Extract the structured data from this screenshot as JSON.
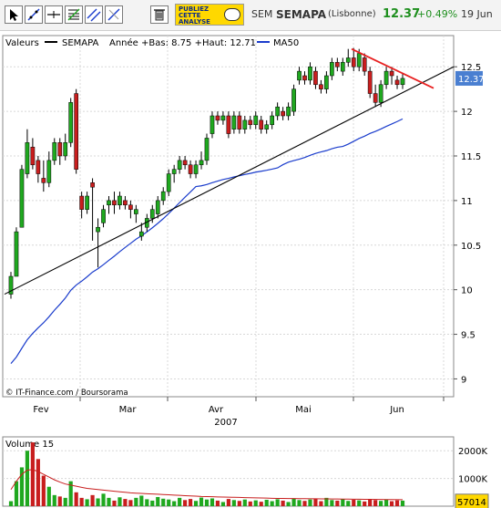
{
  "toolbar": {
    "tools": [
      {
        "icon": "pointer-icon"
      },
      {
        "icon": "trendline-icon"
      },
      {
        "icon": "horizontal-line-icon"
      },
      {
        "icon": "fibonacci-icon"
      },
      {
        "icon": "parallel-lines-icon"
      },
      {
        "icon": "diagonal-line-icon"
      },
      {
        "icon": "trash-icon"
      }
    ],
    "publish_line1": "PUBLIEZ",
    "publish_line2": "CETTE",
    "publish_line3": "ANALYSE",
    "publish_icon": "speech-bubble-icon",
    "market": "SEM",
    "name": "SEMAPA",
    "exchange": "(Lisbonne)",
    "last": "12.37",
    "change": "+0.49%",
    "date": "19 Jun"
  },
  "colors": {
    "up": "#1fa81f",
    "down": "#c81e1e",
    "ma": "#1a3ccc",
    "trend": "#e82020",
    "price_tag_bg": "#4a7fd1"
  },
  "chart_data": {
    "type": "candlestick",
    "legend": {
      "label": "Valeurs",
      "series_name": "SEMAPA",
      "info": "Année +Bas: 8.75 +Haut: 12.71",
      "ma_name": "MA50"
    },
    "y_ticks": [
      "9",
      "9.5",
      "10",
      "10.5",
      "11",
      "11.5",
      "12",
      "12.5"
    ],
    "price_tag": "12.37",
    "x_months": [
      "Fev",
      "Mar",
      "Avr",
      "Mai",
      "Jun"
    ],
    "year": "2007",
    "source": "© IT-Finance.com / Boursorama",
    "candles": [
      [
        9.95,
        10.15,
        9.9,
        10.2
      ],
      [
        10.15,
        10.65,
        10.15,
        10.7
      ],
      [
        10.7,
        11.35,
        10.7,
        11.4
      ],
      [
        11.3,
        11.65,
        11.25,
        11.8
      ],
      [
        11.6,
        11.4,
        11.35,
        11.7
      ],
      [
        11.45,
        11.3,
        11.2,
        11.5
      ],
      [
        11.25,
        11.2,
        11.1,
        11.45
      ],
      [
        11.2,
        11.45,
        11.15,
        11.55
      ],
      [
        11.45,
        11.65,
        11.4,
        11.7
      ],
      [
        11.65,
        11.5,
        11.4,
        11.7
      ],
      [
        11.5,
        11.65,
        11.45,
        11.75
      ],
      [
        11.65,
        12.1,
        11.6,
        12.15
      ],
      [
        12.2,
        11.35,
        11.3,
        12.25
      ],
      [
        11.05,
        10.9,
        10.8,
        11.1
      ],
      [
        10.9,
        11.05,
        10.85,
        11.1
      ],
      [
        11.2,
        11.15,
        10.55,
        11.25
      ],
      [
        10.65,
        10.7,
        10.25,
        10.8
      ],
      [
        10.75,
        10.9,
        10.7,
        10.95
      ],
      [
        10.95,
        11.0,
        10.85,
        11.05
      ],
      [
        11.0,
        10.95,
        10.85,
        11.1
      ],
      [
        10.95,
        11.05,
        10.9,
        11.1
      ],
      [
        11.0,
        10.95,
        10.9,
        11.05
      ],
      [
        10.95,
        10.9,
        10.8,
        11.0
      ],
      [
        10.85,
        10.9,
        10.75,
        10.95
      ],
      [
        10.6,
        10.65,
        10.55,
        10.75
      ],
      [
        10.7,
        10.8,
        10.65,
        10.85
      ],
      [
        10.8,
        10.9,
        10.75,
        10.95
      ],
      [
        10.85,
        11.0,
        10.8,
        11.05
      ],
      [
        11.0,
        11.1,
        10.95,
        11.15
      ],
      [
        11.1,
        11.3,
        11.05,
        11.35
      ],
      [
        11.3,
        11.35,
        11.2,
        11.4
      ],
      [
        11.35,
        11.45,
        11.3,
        11.5
      ],
      [
        11.45,
        11.4,
        11.35,
        11.5
      ],
      [
        11.4,
        11.3,
        11.25,
        11.45
      ],
      [
        11.3,
        11.4,
        11.25,
        11.45
      ],
      [
        11.4,
        11.45,
        11.35,
        11.55
      ],
      [
        11.45,
        11.7,
        11.4,
        11.75
      ],
      [
        11.75,
        11.95,
        11.7,
        12.0
      ],
      [
        11.95,
        11.9,
        11.85,
        12.0
      ],
      [
        11.9,
        11.95,
        11.85,
        12.0
      ],
      [
        11.95,
        11.75,
        11.7,
        12.0
      ],
      [
        11.8,
        11.95,
        11.75,
        12.0
      ],
      [
        11.95,
        11.8,
        11.75,
        12.0
      ],
      [
        11.8,
        11.9,
        11.75,
        11.95
      ],
      [
        11.9,
        11.85,
        11.8,
        11.95
      ],
      [
        11.85,
        11.95,
        11.8,
        12.0
      ],
      [
        11.9,
        11.8,
        11.75,
        11.95
      ],
      [
        11.8,
        11.85,
        11.75,
        11.9
      ],
      [
        11.85,
        11.95,
        11.8,
        12.0
      ],
      [
        11.95,
        12.05,
        11.9,
        12.1
      ],
      [
        12.0,
        11.95,
        11.9,
        12.05
      ],
      [
        11.95,
        12.05,
        11.9,
        12.1
      ],
      [
        12.0,
        12.25,
        11.95,
        12.3
      ],
      [
        12.35,
        12.45,
        12.3,
        12.5
      ],
      [
        12.4,
        12.35,
        12.3,
        12.45
      ],
      [
        12.35,
        12.5,
        12.3,
        12.55
      ],
      [
        12.45,
        12.3,
        12.25,
        12.5
      ],
      [
        12.3,
        12.25,
        12.2,
        12.35
      ],
      [
        12.25,
        12.4,
        12.2,
        12.45
      ],
      [
        12.4,
        12.55,
        12.35,
        12.6
      ],
      [
        12.55,
        12.5,
        12.45,
        12.6
      ],
      [
        12.45,
        12.55,
        12.4,
        12.6
      ],
      [
        12.55,
        12.6,
        12.5,
        12.7
      ],
      [
        12.6,
        12.5,
        12.45,
        12.71
      ],
      [
        12.5,
        12.65,
        12.45,
        12.7
      ],
      [
        12.6,
        12.45,
        12.4,
        12.65
      ],
      [
        12.45,
        12.2,
        12.15,
        12.5
      ],
      [
        12.2,
        12.1,
        12.05,
        12.3
      ],
      [
        12.1,
        12.3,
        12.05,
        12.35
      ],
      [
        12.3,
        12.45,
        12.25,
        12.5
      ],
      [
        12.45,
        12.4,
        12.3,
        12.5
      ],
      [
        12.35,
        12.3,
        12.25,
        12.4
      ],
      [
        12.3,
        12.37,
        12.25,
        12.42
      ]
    ],
    "volume": {
      "label": "Volume 15",
      "y_ticks": [
        "2000K",
        "1000K"
      ],
      "last_tag": "57014",
      "values": [
        180,
        900,
        1400,
        2000,
        2300,
        1700,
        1100,
        700,
        400,
        350,
        300,
        900,
        500,
        300,
        250,
        400,
        280,
        450,
        300,
        200,
        320,
        260,
        220,
        300,
        380,
        250,
        200,
        330,
        270,
        240,
        180,
        300,
        220,
        260,
        190,
        310,
        240,
        280,
        200,
        150,
        260,
        220,
        190,
        240,
        170,
        210,
        160,
        230,
        180,
        250,
        200,
        150,
        280,
        220,
        190,
        240,
        260,
        180,
        300,
        220,
        200,
        250,
        190,
        230,
        210,
        170,
        260,
        220,
        190,
        240,
        180,
        210,
        200
      ],
      "ma": [
        600,
        900,
        1150,
        1300,
        1320,
        1250,
        1150,
        1050,
        950,
        870,
        800,
        760,
        720,
        680,
        640,
        620,
        600,
        580,
        560,
        540,
        520,
        500,
        480,
        470,
        460,
        450,
        440,
        430,
        420,
        410,
        400,
        390,
        380,
        370,
        360,
        350,
        345,
        340,
        335,
        330,
        325,
        320,
        315,
        310,
        305,
        300,
        295,
        290,
        285,
        280,
        278,
        276,
        274,
        272,
        270,
        268,
        266,
        264,
        262,
        260,
        258,
        256,
        254,
        252,
        250,
        248,
        246,
        244,
        242,
        240,
        238,
        236,
        234
      ]
    }
  }
}
